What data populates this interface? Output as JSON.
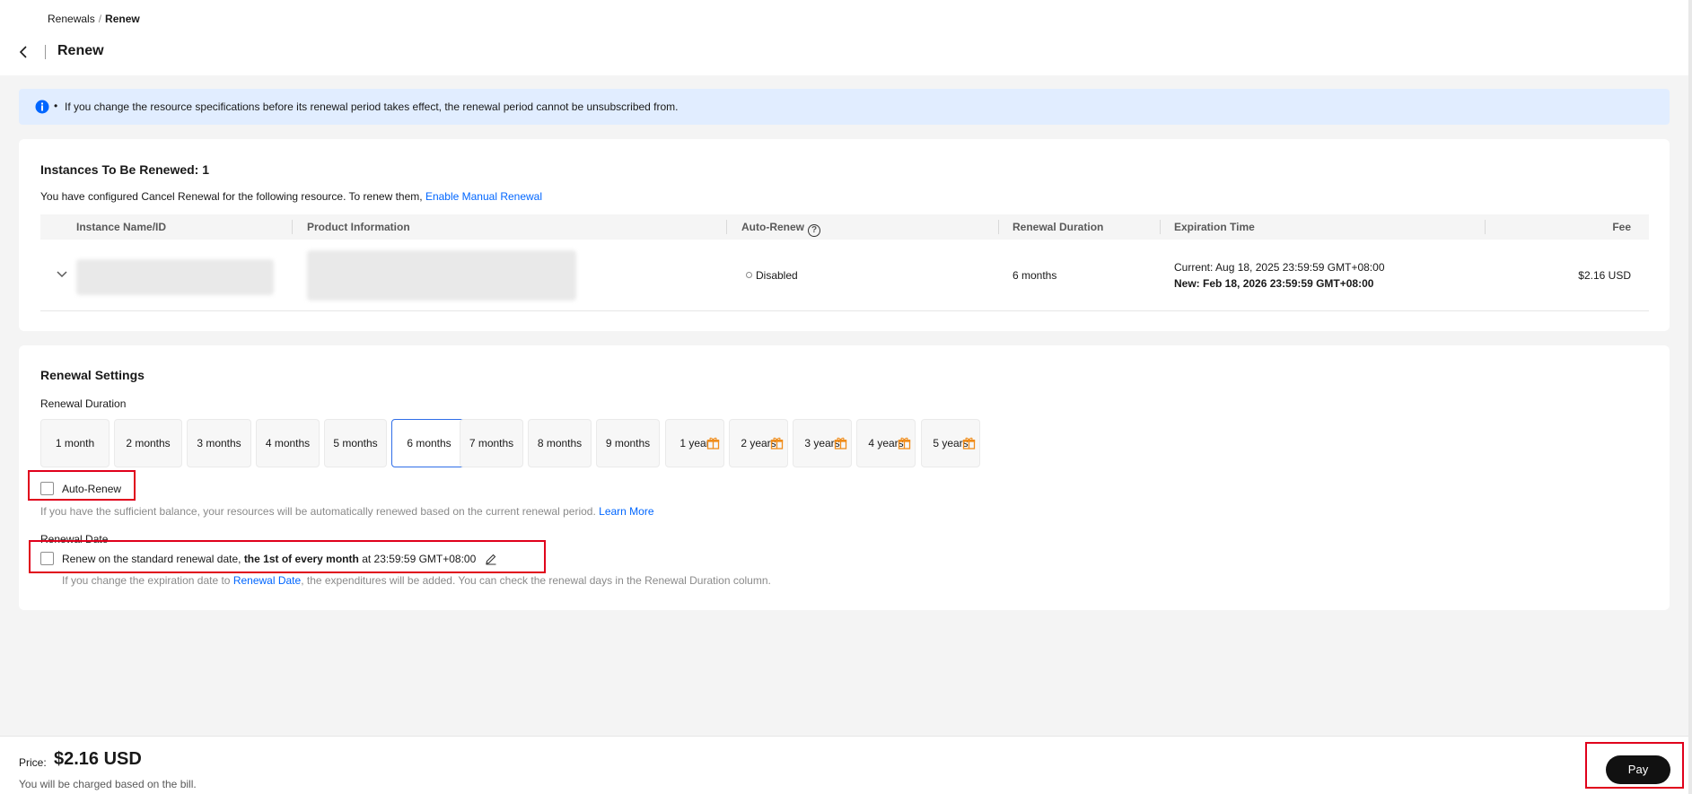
{
  "breadcrumb": {
    "parent": "Renewals",
    "separator": "/",
    "current": "Renew"
  },
  "header": {
    "title": "Renew"
  },
  "notice": {
    "bullet": "•",
    "text": "If you change the resource specifications before its renewal period takes effect, the renewal period cannot be unsubscribed from."
  },
  "instances": {
    "title": "Instances To Be Renewed: 1",
    "note": "You have configured Cancel Renewal for the following resource. To renew them,",
    "link": "Enable Manual Renewal",
    "columns": {
      "instance": "Instance Name/ID",
      "product": "Product Information",
      "auto_renew": "Auto-Renew",
      "duration": "Renewal Duration",
      "expiration": "Expiration Time",
      "fee": "Fee"
    },
    "rows": [
      {
        "auto_renew": "Disabled",
        "duration": "6 months",
        "current_expiration": "Current: Aug 18, 2025 23:59:59 GMT+08:00",
        "new_expiration": "New: Feb 18, 2026 23:59:59 GMT+08:00",
        "fee": "$2.16 USD"
      }
    ]
  },
  "settings": {
    "title": "Renewal Settings",
    "duration_label": "Renewal Duration",
    "durations": [
      {
        "label": "1 month",
        "gift": false
      },
      {
        "label": "2 months",
        "gift": false
      },
      {
        "label": "3 months",
        "gift": false
      },
      {
        "label": "4 months",
        "gift": false
      },
      {
        "label": "5 months",
        "gift": false
      },
      {
        "label": "6 months",
        "gift": false,
        "selected": true
      },
      {
        "label": "7 months",
        "gift": false
      },
      {
        "label": "8 months",
        "gift": false
      },
      {
        "label": "9 months",
        "gift": false
      },
      {
        "label": "1 year",
        "gift": true
      },
      {
        "label": "2 years",
        "gift": true
      },
      {
        "label": "3 years",
        "gift": true
      },
      {
        "label": "4 years",
        "gift": true
      },
      {
        "label": "5 years",
        "gift": true
      }
    ],
    "auto_renew_label": "Auto-Renew",
    "auto_renew_checked": false,
    "auto_renew_note": "If you have the sufficient balance, your resources will be automatically renewed based on the current renewal period.",
    "learn_more": "Learn More",
    "renewal_date_label": "Renewal Date",
    "renewal_date_checked": false,
    "renewal_date_prefix": "Renew on the standard renewal date,",
    "renewal_date_bold": "the 1st of every month",
    "renewal_date_suffix": "at 23:59:59 GMT+08:00",
    "expiry_note_prefix": "If you change the expiration date to",
    "expiry_note_link": "Renewal Date",
    "expiry_note_suffix": ", the expenditures will be added. You can check the renewal days in the Renewal Duration column."
  },
  "footer": {
    "price_label": "Price:",
    "price_value": "$2.16 USD",
    "charge_note": "You will be charged based on the bill.",
    "pay_label": "Pay"
  },
  "colors": {
    "accent": "#0066ff",
    "notice_bg": "#e1edff",
    "highlight": "#e0001b",
    "gift": "#f08c1a",
    "pay_bg": "#111111"
  }
}
